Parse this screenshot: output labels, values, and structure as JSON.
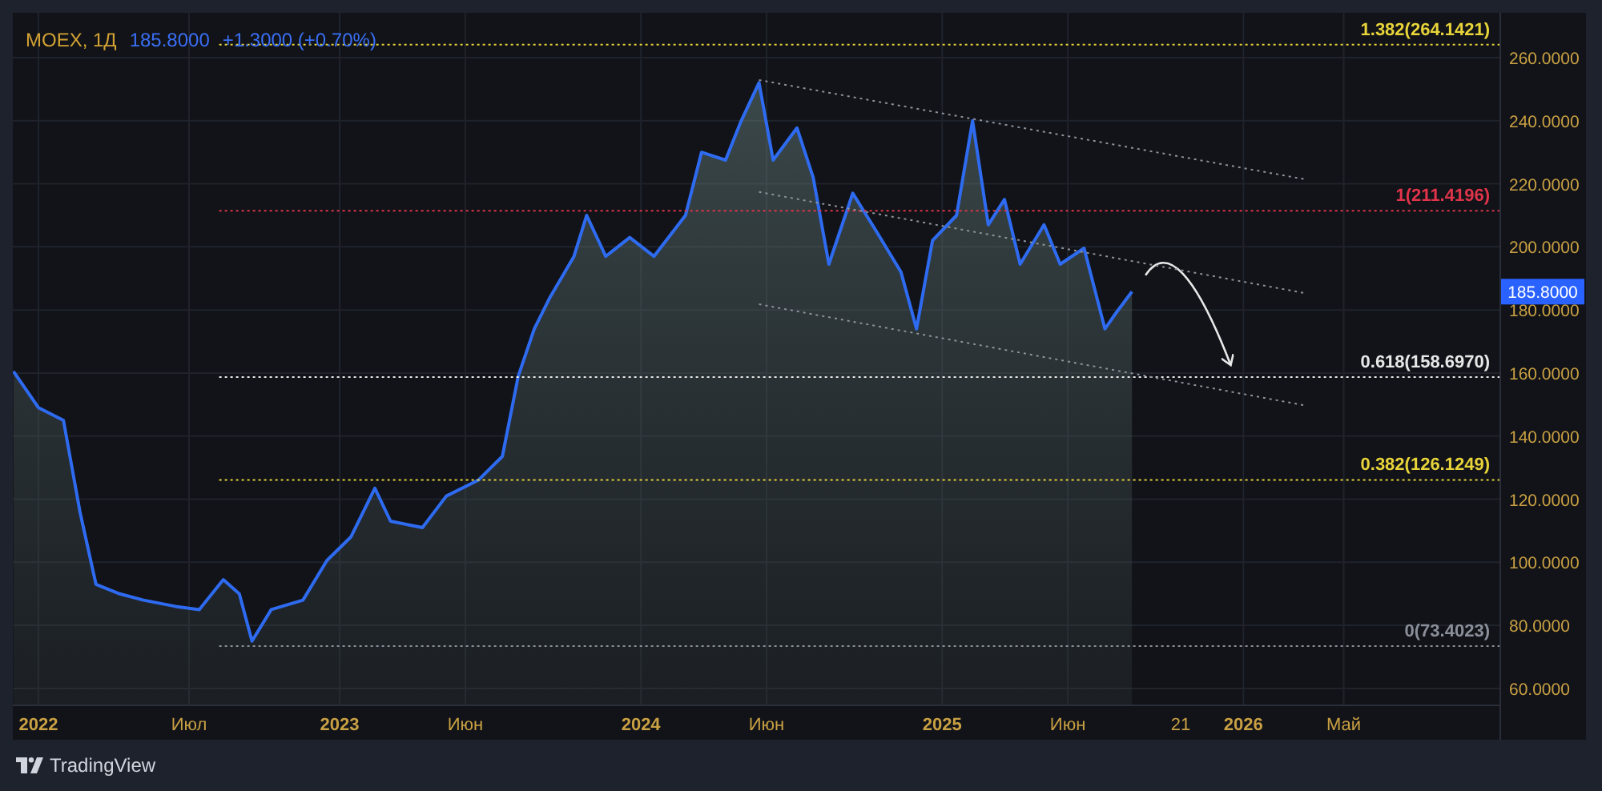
{
  "header": {
    "symbol": "MOEX, 1Д",
    "price": "185.8000",
    "change": "+1.3000 (+0.70%)"
  },
  "price_tag": "185.8000",
  "chart_data": {
    "type": "area",
    "xlim": [
      2021.915,
      2026.85
    ],
    "ylim": [
      54.9,
      274.2
    ],
    "x": [
      2021.917,
      2022,
      2022.083,
      2022.138,
      2022.191,
      2022.27,
      2022.349,
      2022.455,
      2022.534,
      2022.614,
      2022.667,
      2022.709,
      2022.773,
      2022.878,
      2022.958,
      2023.037,
      2023.117,
      2023.169,
      2023.275,
      2023.354,
      2023.46,
      2023.54,
      2023.593,
      2023.646,
      2023.698,
      2023.778,
      2023.82,
      2023.883,
      2023.963,
      2024.043,
      2024.148,
      2024.201,
      2024.281,
      2024.333,
      2024.392,
      2024.439,
      2024.518,
      2024.572,
      2024.624,
      2024.703,
      2024.783,
      2024.863,
      2024.915,
      2024.968,
      2025.048,
      2025.101,
      2025.153,
      2025.207,
      2025.259,
      2025.338,
      2025.392,
      2025.471,
      2025.54,
      2025.577,
      2025.63
    ],
    "series": [
      {
        "color": "#2e6bf0",
        "values": [
          160.5,
          149,
          145,
          116,
          93,
          90,
          88,
          86,
          85,
          94.5,
          90,
          75,
          85,
          88,
          100.6,
          108,
          123.5,
          113,
          111,
          121,
          126,
          133.6,
          159,
          174,
          184,
          197,
          210,
          197,
          203,
          197,
          210,
          230,
          227.5,
          240,
          252,
          227.5,
          237.7,
          222,
          194.5,
          217,
          204.7,
          192,
          174,
          202,
          210,
          240,
          207,
          215,
          194.5,
          207,
          194.5,
          199.6,
          174,
          179,
          185.8
        ]
      }
    ],
    "yticks": [
      {
        "value": 60,
        "label": "60.0000"
      },
      {
        "value": 80,
        "label": "80.0000"
      },
      {
        "value": 100,
        "label": "100.0000"
      },
      {
        "value": 120,
        "label": "120.0000"
      },
      {
        "value": 140,
        "label": "140.0000"
      },
      {
        "value": 160,
        "label": "160.0000"
      },
      {
        "value": 180,
        "label": "180.0000"
      },
      {
        "value": 200,
        "label": "200.0000"
      },
      {
        "value": 220,
        "label": "220.0000"
      },
      {
        "value": 240,
        "label": "240.0000"
      },
      {
        "value": 260,
        "label": "260.0000"
      }
    ],
    "xticks": [
      {
        "value": 2022,
        "label": "2022"
      },
      {
        "value": 2022.5,
        "label": "Июл"
      },
      {
        "value": 2023,
        "label": "2023"
      },
      {
        "value": 2023.417,
        "label": "Июн"
      },
      {
        "value": 2024,
        "label": "2024"
      },
      {
        "value": 2024.417,
        "label": "Июн"
      },
      {
        "value": 2025,
        "label": "2025"
      },
      {
        "value": 2025.417,
        "label": "Июн"
      },
      {
        "value": 2026,
        "label": "2026"
      },
      {
        "value": 2026.333,
        "label": "Май"
      }
    ],
    "grid": true,
    "ref_lines": [
      {
        "axis": "y",
        "value": 264.1421,
        "label": "1.382(264.1421)",
        "color": "#e8d43a"
      },
      {
        "axis": "y",
        "value": 211.4196,
        "label": "1(211.4196)",
        "color": "#e0344a"
      },
      {
        "axis": "y",
        "value": 158.697,
        "label": "0.618(158.6970)",
        "color": "#e8e8e8"
      },
      {
        "axis": "y",
        "value": 126.1249,
        "label": "0.382(126.1249)",
        "color": "#e8d43a"
      },
      {
        "axis": "y",
        "value": 73.4023,
        "label": "0(73.4023)",
        "color": "#8a8f99"
      }
    ]
  },
  "x_axis_day_label": "21",
  "footer": {
    "brand": "TradingView"
  }
}
